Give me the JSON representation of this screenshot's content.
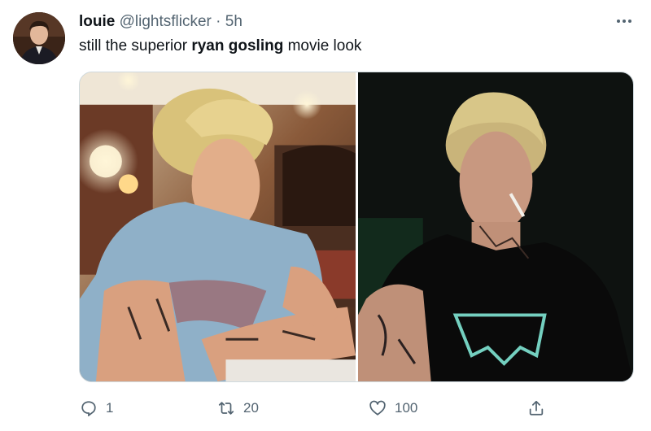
{
  "tweet": {
    "author_name": "louie",
    "author_handle": "@lightsflicker",
    "separator": "·",
    "time": "5h",
    "text_before": "still the superior ",
    "text_bold": "ryan gosling",
    "text_after": " movie look",
    "more_icon": "more-horizontal-icon"
  },
  "media": {
    "images": [
      {
        "name": "diner-scene-photo"
      },
      {
        "name": "dark-scene-photo"
      }
    ]
  },
  "actions": {
    "reply_count": "1",
    "retweet_count": "20",
    "like_count": "100",
    "icons": [
      "reply-icon",
      "retweet-icon",
      "like-icon",
      "share-icon"
    ]
  },
  "colors": {
    "text_primary": "#0f1419",
    "text_secondary": "#536471",
    "border": "#cfd9de"
  }
}
